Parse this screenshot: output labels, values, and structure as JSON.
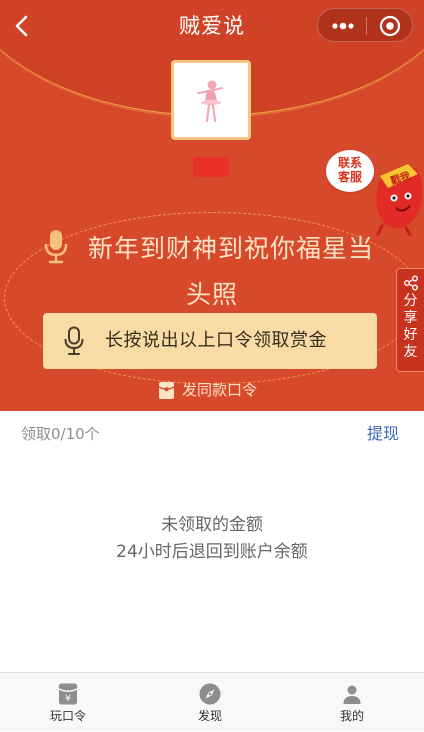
{
  "header": {
    "title": "贼爱说",
    "back_icon": "chevron-left-icon",
    "menu_icons": [
      "more-dots-icon",
      "target-circle-icon"
    ]
  },
  "floating": {
    "contact_service": "联系客服",
    "share_friends": "分享好友"
  },
  "red_packet": {
    "slogan": "新年到财神到祝你福星当头照",
    "hold_button_label": "长按说出以上口令领取赏金",
    "send_same": "发同款口令"
  },
  "records": {
    "received_count": "领取0/10个",
    "withdraw": "提现",
    "empty_line1": "未领取的金额",
    "empty_line2": "24小时后退回到账户余额"
  },
  "tabbar": [
    {
      "label": "玩口令",
      "icon": "yen-packet-icon"
    },
    {
      "label": "发现",
      "icon": "compass-icon"
    },
    {
      "label": "我的",
      "icon": "user-icon"
    }
  ],
  "colors": {
    "primary_red": "#d64a2b",
    "button_beige": "#f7dca5",
    "link_blue": "#3b66b5"
  }
}
